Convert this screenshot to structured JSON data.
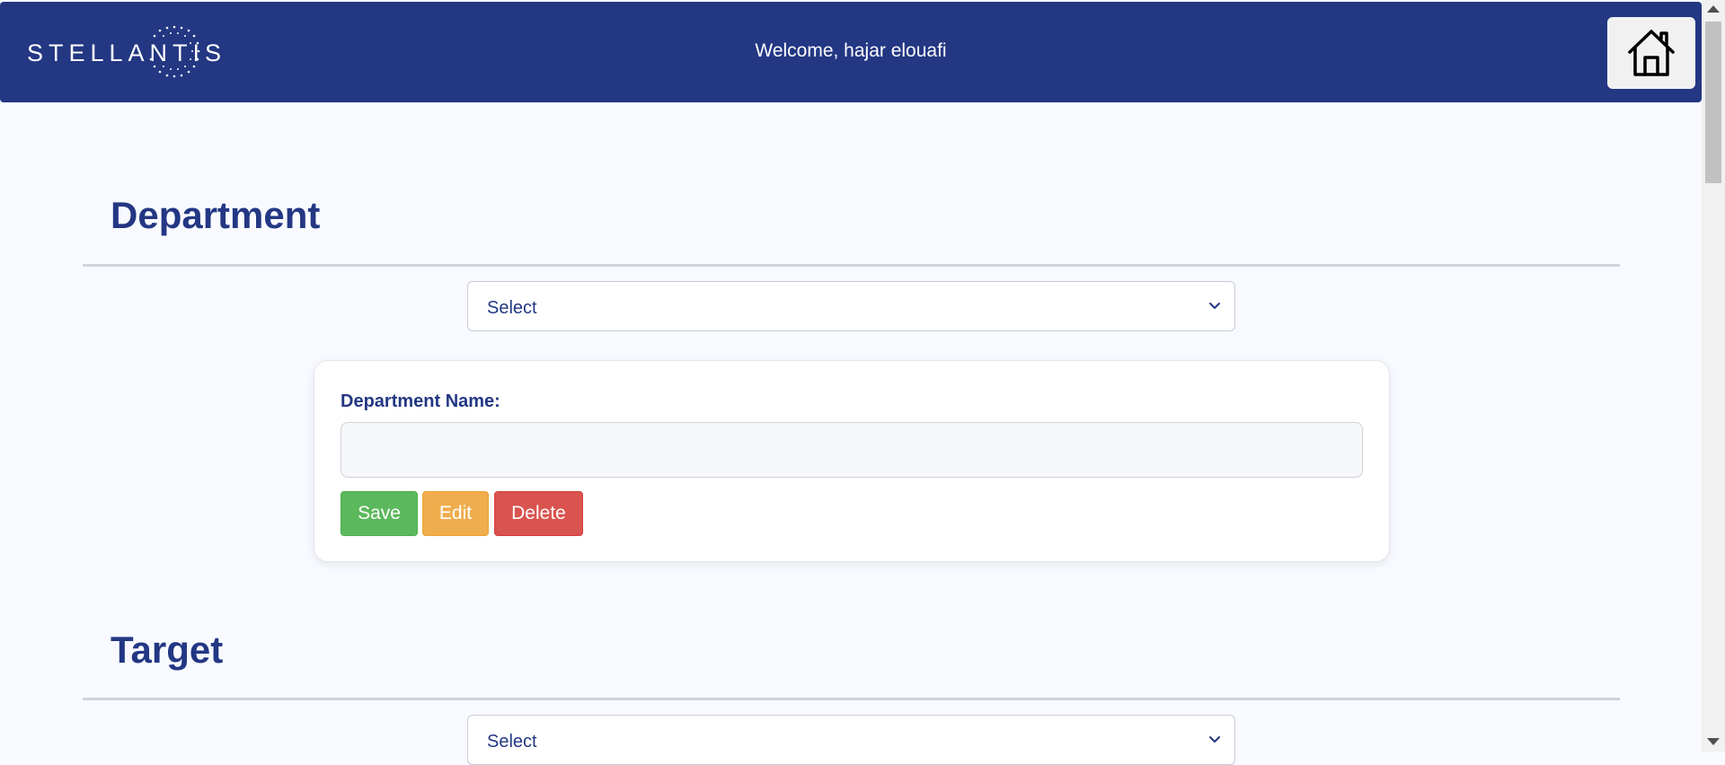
{
  "header": {
    "logo_text": "STELLANTIS",
    "welcome": "Welcome, hajar elouafi",
    "home_icon": "home-icon",
    "background_color": "#233783"
  },
  "department": {
    "title": "Department",
    "select_value": "Select",
    "card": {
      "label": "Department Name:",
      "input_value": "",
      "buttons": {
        "save": "Save",
        "edit": "Edit",
        "delete": "Delete"
      }
    }
  },
  "target": {
    "title": "Target",
    "select_value": "Select"
  },
  "colors": {
    "accent": "#233783",
    "save": "#5cb85c",
    "edit": "#f0ad4e",
    "delete": "#d9534f"
  }
}
